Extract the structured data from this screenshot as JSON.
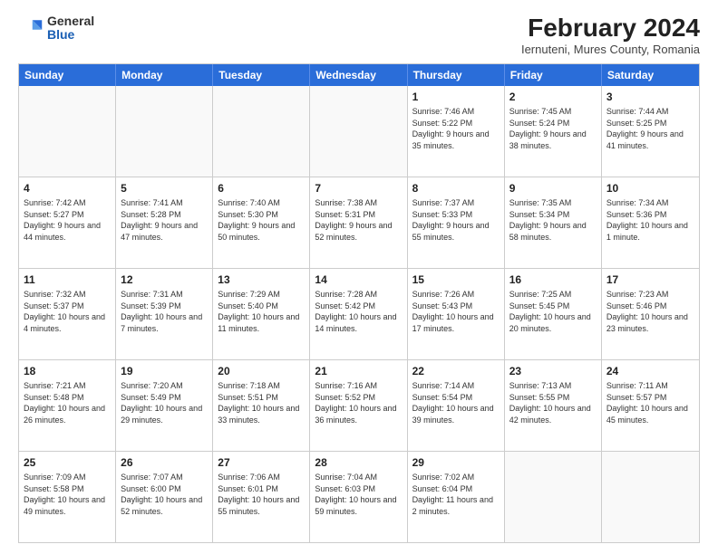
{
  "logo": {
    "general": "General",
    "blue": "Blue"
  },
  "title": "February 2024",
  "subtitle": "Iernuteni, Mures County, Romania",
  "header_days": [
    "Sunday",
    "Monday",
    "Tuesday",
    "Wednesday",
    "Thursday",
    "Friday",
    "Saturday"
  ],
  "rows": [
    [
      {
        "day": "",
        "content": ""
      },
      {
        "day": "",
        "content": ""
      },
      {
        "day": "",
        "content": ""
      },
      {
        "day": "",
        "content": ""
      },
      {
        "day": "1",
        "content": "Sunrise: 7:46 AM\nSunset: 5:22 PM\nDaylight: 9 hours\nand 35 minutes."
      },
      {
        "day": "2",
        "content": "Sunrise: 7:45 AM\nSunset: 5:24 PM\nDaylight: 9 hours\nand 38 minutes."
      },
      {
        "day": "3",
        "content": "Sunrise: 7:44 AM\nSunset: 5:25 PM\nDaylight: 9 hours\nand 41 minutes."
      }
    ],
    [
      {
        "day": "4",
        "content": "Sunrise: 7:42 AM\nSunset: 5:27 PM\nDaylight: 9 hours\nand 44 minutes."
      },
      {
        "day": "5",
        "content": "Sunrise: 7:41 AM\nSunset: 5:28 PM\nDaylight: 9 hours\nand 47 minutes."
      },
      {
        "day": "6",
        "content": "Sunrise: 7:40 AM\nSunset: 5:30 PM\nDaylight: 9 hours\nand 50 minutes."
      },
      {
        "day": "7",
        "content": "Sunrise: 7:38 AM\nSunset: 5:31 PM\nDaylight: 9 hours\nand 52 minutes."
      },
      {
        "day": "8",
        "content": "Sunrise: 7:37 AM\nSunset: 5:33 PM\nDaylight: 9 hours\nand 55 minutes."
      },
      {
        "day": "9",
        "content": "Sunrise: 7:35 AM\nSunset: 5:34 PM\nDaylight: 9 hours\nand 58 minutes."
      },
      {
        "day": "10",
        "content": "Sunrise: 7:34 AM\nSunset: 5:36 PM\nDaylight: 10 hours\nand 1 minute."
      }
    ],
    [
      {
        "day": "11",
        "content": "Sunrise: 7:32 AM\nSunset: 5:37 PM\nDaylight: 10 hours\nand 4 minutes."
      },
      {
        "day": "12",
        "content": "Sunrise: 7:31 AM\nSunset: 5:39 PM\nDaylight: 10 hours\nand 7 minutes."
      },
      {
        "day": "13",
        "content": "Sunrise: 7:29 AM\nSunset: 5:40 PM\nDaylight: 10 hours\nand 11 minutes."
      },
      {
        "day": "14",
        "content": "Sunrise: 7:28 AM\nSunset: 5:42 PM\nDaylight: 10 hours\nand 14 minutes."
      },
      {
        "day": "15",
        "content": "Sunrise: 7:26 AM\nSunset: 5:43 PM\nDaylight: 10 hours\nand 17 minutes."
      },
      {
        "day": "16",
        "content": "Sunrise: 7:25 AM\nSunset: 5:45 PM\nDaylight: 10 hours\nand 20 minutes."
      },
      {
        "day": "17",
        "content": "Sunrise: 7:23 AM\nSunset: 5:46 PM\nDaylight: 10 hours\nand 23 minutes."
      }
    ],
    [
      {
        "day": "18",
        "content": "Sunrise: 7:21 AM\nSunset: 5:48 PM\nDaylight: 10 hours\nand 26 minutes."
      },
      {
        "day": "19",
        "content": "Sunrise: 7:20 AM\nSunset: 5:49 PM\nDaylight: 10 hours\nand 29 minutes."
      },
      {
        "day": "20",
        "content": "Sunrise: 7:18 AM\nSunset: 5:51 PM\nDaylight: 10 hours\nand 33 minutes."
      },
      {
        "day": "21",
        "content": "Sunrise: 7:16 AM\nSunset: 5:52 PM\nDaylight: 10 hours\nand 36 minutes."
      },
      {
        "day": "22",
        "content": "Sunrise: 7:14 AM\nSunset: 5:54 PM\nDaylight: 10 hours\nand 39 minutes."
      },
      {
        "day": "23",
        "content": "Sunrise: 7:13 AM\nSunset: 5:55 PM\nDaylight: 10 hours\nand 42 minutes."
      },
      {
        "day": "24",
        "content": "Sunrise: 7:11 AM\nSunset: 5:57 PM\nDaylight: 10 hours\nand 45 minutes."
      }
    ],
    [
      {
        "day": "25",
        "content": "Sunrise: 7:09 AM\nSunset: 5:58 PM\nDaylight: 10 hours\nand 49 minutes."
      },
      {
        "day": "26",
        "content": "Sunrise: 7:07 AM\nSunset: 6:00 PM\nDaylight: 10 hours\nand 52 minutes."
      },
      {
        "day": "27",
        "content": "Sunrise: 7:06 AM\nSunset: 6:01 PM\nDaylight: 10 hours\nand 55 minutes."
      },
      {
        "day": "28",
        "content": "Sunrise: 7:04 AM\nSunset: 6:03 PM\nDaylight: 10 hours\nand 59 minutes."
      },
      {
        "day": "29",
        "content": "Sunrise: 7:02 AM\nSunset: 6:04 PM\nDaylight: 11 hours\nand 2 minutes."
      },
      {
        "day": "",
        "content": ""
      },
      {
        "day": "",
        "content": ""
      }
    ]
  ]
}
